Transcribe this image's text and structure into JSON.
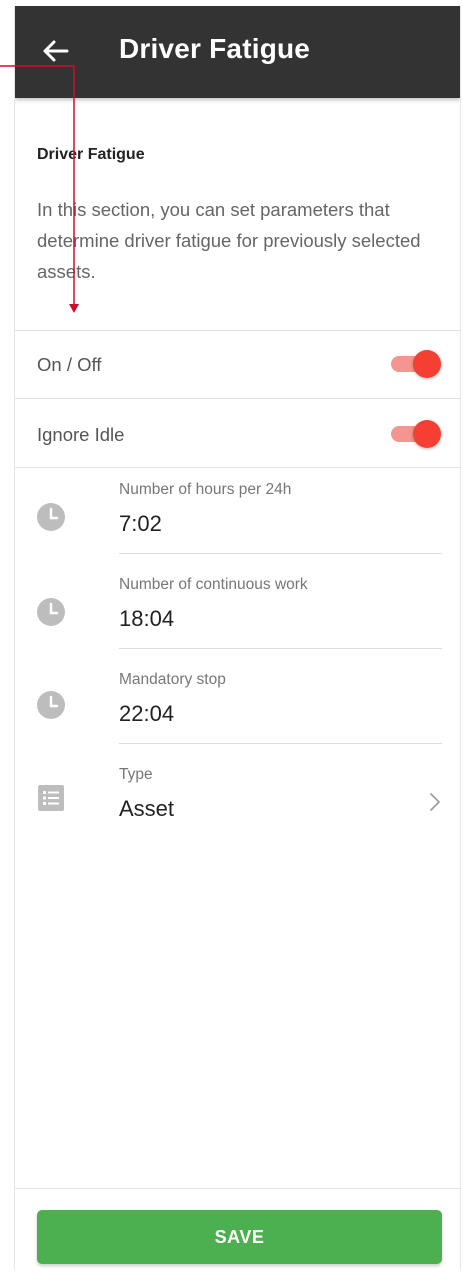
{
  "appbar": {
    "title": "Driver Fatigue",
    "back_icon": "arrow-left-icon"
  },
  "section": {
    "title": "Driver Fatigue",
    "description": "In this section, you can set parameters that determine driver fatigue for previously selected assets."
  },
  "toggles": [
    {
      "label": "On / Off",
      "on": true
    },
    {
      "label": "Ignore Idle",
      "on": true
    }
  ],
  "fields": [
    {
      "label": "Number of hours per 24h",
      "value": "7:02",
      "icon": "clock-icon"
    },
    {
      "label": "Number of continuous work",
      "value": "18:04",
      "icon": "clock-icon"
    },
    {
      "label": "Mandatory stop",
      "value": "22:04",
      "icon": "clock-icon"
    },
    {
      "label": "Type",
      "value": "Asset",
      "icon": "list-icon"
    }
  ],
  "save_label": "SAVE",
  "colors": {
    "appbar": "#333333",
    "toggle_thumb": "#f43f32",
    "toggle_track": "#f4968f",
    "save_button": "#4caf50",
    "annotation_arrow": "#c8102e"
  }
}
